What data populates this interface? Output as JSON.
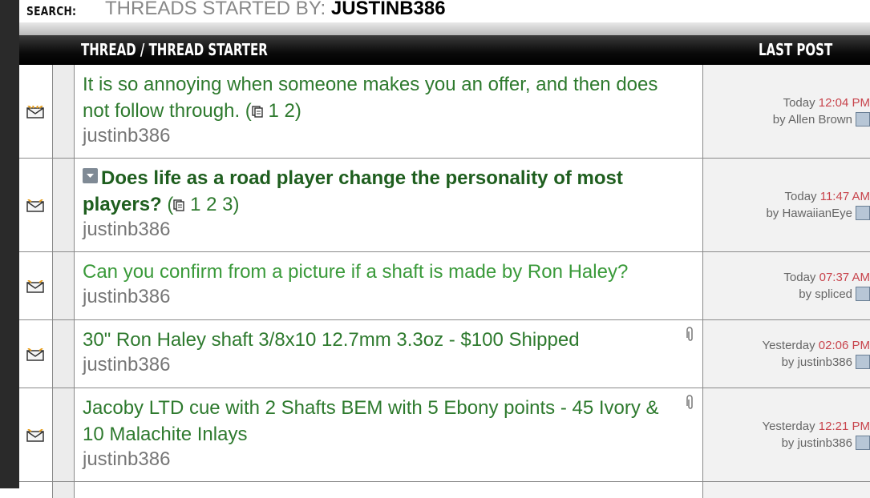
{
  "search": {
    "label": "SEARCH:",
    "description": "THREADS STARTED BY:",
    "username": "JUSTINB386"
  },
  "columns": {
    "thread": "THREAD / THREAD STARTER",
    "last_post": "LAST POST"
  },
  "threads": [
    {
      "title": "It is so annoying when someone makes you an offer, and then does not follow through.",
      "pages": [
        "1",
        "2"
      ],
      "starter": "justinb386",
      "last_post_day": "Today",
      "last_post_time": "12:04 PM",
      "last_post_by": "by Allen Brown"
    },
    {
      "title": "Does life as a road player change the personality of most players?",
      "pages": [
        "1",
        "2",
        "3"
      ],
      "starter": "justinb386",
      "last_post_day": "Today",
      "last_post_time": "11:47 AM",
      "last_post_by": "by HawaiianEye"
    },
    {
      "title": "Can you confirm from a picture if a shaft is made by Ron Haley?",
      "starter": "justinb386",
      "last_post_day": "Today",
      "last_post_time": "07:37 AM",
      "last_post_by": "by spliced"
    },
    {
      "title": "30\" Ron Haley shaft 3/8x10 12.7mm 3.3oz - $100 Shipped",
      "starter": "justinb386",
      "last_post_day": "Yesterday",
      "last_post_time": "02:06 PM",
      "last_post_by": "by justinb386"
    },
    {
      "title": "Jacoby LTD cue with 2 Shafts BEM with 5 Ebony points - 45 Ivory & 10 Malachite Inlays",
      "starter": "justinb386",
      "last_post_day": "Yesterday",
      "last_post_time": "12:21 PM",
      "last_post_by": "by justinb386"
    }
  ],
  "icons": {
    "status": "envelope-icon",
    "pages": "pages-icon",
    "attachment": "paperclip-icon",
    "go_to_last": "arrow-right-icon",
    "thread_prefix": "expand-icon"
  }
}
